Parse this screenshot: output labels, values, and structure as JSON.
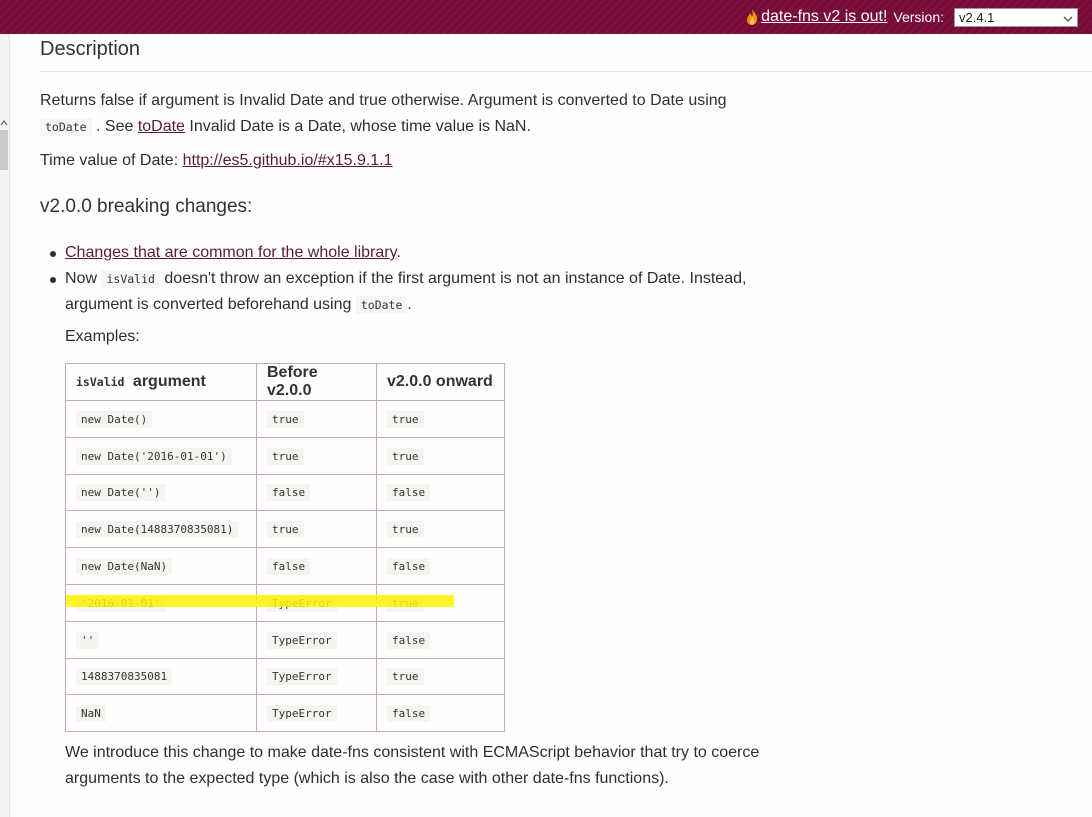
{
  "topbar": {
    "announce_link": "date-fns v2 is out!",
    "version_label": "Version:",
    "version_selected": "v2.4.1",
    "icons": [
      "flame-icon",
      "chevron-down-icon"
    ],
    "colors": {
      "bar": "#770a38",
      "link": "#5a1b3c",
      "highlight": "#fff200"
    }
  },
  "description": {
    "heading": "Description",
    "p1_a": "Returns false if argument is Invalid Date and true otherwise. Argument is converted to Date using",
    "p1_code": "toDate",
    "p1_b": ". See",
    "p1_link": "toDate",
    "p1_c": "Invalid Date is a Date, whose time value is NaN.",
    "p2_text": "Time value of Date:",
    "p2_link": "http://es5.github.io/#x15.9.1.1"
  },
  "breaking": {
    "heading": "v2.0.0 breaking changes:",
    "item1_link": "Changes that are common for the whole library",
    "item1_end": ".",
    "item2_a": "Now",
    "item2_code": "isValid",
    "item2_b": "doesn't throw an exception if the first argument is not an instance of Date. Instead,",
    "item2_c": "argument is converted beforehand using",
    "item2_code2": "toDate",
    "item2_end": ".",
    "examples_label": "Examples:"
  },
  "table": {
    "header_code": "isValid",
    "header_arg": "argument",
    "header_before": "Before v2.0.0",
    "header_after": "v2.0.0 onward",
    "rows": [
      {
        "arg": "new Date()",
        "before": "true",
        "after": "true"
      },
      {
        "arg": "new Date('2016-01-01')",
        "before": "true",
        "after": "true"
      },
      {
        "arg": "new Date('')",
        "before": "false",
        "after": "false"
      },
      {
        "arg": "new Date(1488370835081)",
        "before": "true",
        "after": "true"
      },
      {
        "arg": "new Date(NaN)",
        "before": "false",
        "after": "false"
      },
      {
        "arg": "'2016-01-01'",
        "before": "TypeError",
        "after": "true"
      },
      {
        "arg": "''",
        "before": "TypeError",
        "after": "false"
      },
      {
        "arg": "1488370835081",
        "before": "TypeError",
        "after": "true"
      },
      {
        "arg": "NaN",
        "before": "TypeError",
        "after": "false"
      }
    ]
  },
  "outro": {
    "line1": "We introduce this change to make date-fns consistent with ECMAScript behavior that try to coerce",
    "line2": "arguments to the expected type (which is also the case with other date-fns functions)."
  }
}
